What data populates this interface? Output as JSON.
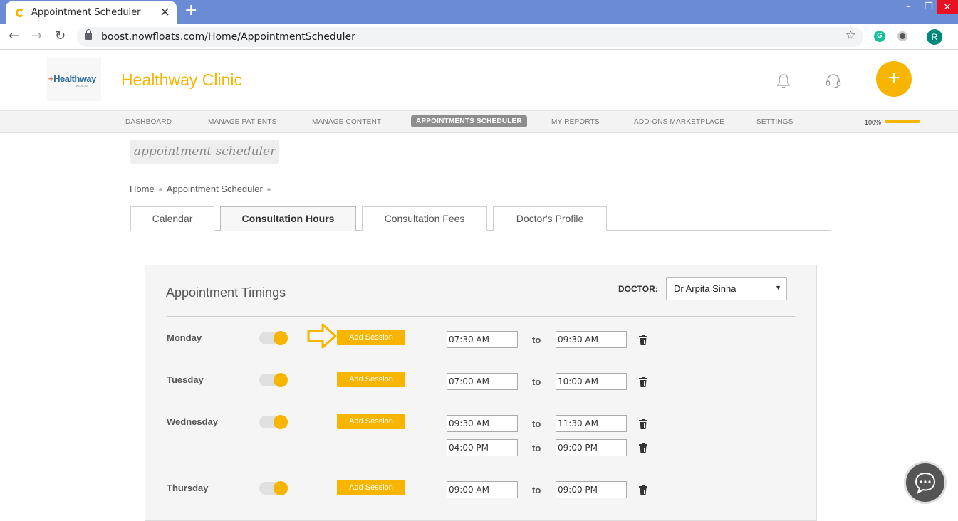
{
  "browser": {
    "tab_title": "Appointment Scheduler",
    "url": "boost.nowfloats.com/Home/AppointmentScheduler",
    "profile_initial": "R",
    "extension_initial": "G"
  },
  "header": {
    "logo_plus": "+",
    "logo_text": "Healthway",
    "logo_sub": "MEDICAL",
    "clinic_name": "Healthway Clinic",
    "add_label": "+"
  },
  "nav": {
    "items": [
      {
        "label": "DASHBOARD"
      },
      {
        "label": "MANAGE PATIENTS"
      },
      {
        "label": "MANAGE CONTENT"
      },
      {
        "label": "APPOINTMENTS SCHEDULER"
      },
      {
        "label": "MY REPORTS"
      },
      {
        "label": "ADD-ONS MARKETPLACE"
      },
      {
        "label": "SETTINGS"
      }
    ],
    "progress_label": "100%",
    "progress_fraction": 1.0
  },
  "page": {
    "title": "appointment scheduler",
    "breadcrumb": [
      "Home",
      "Appointment Scheduler"
    ]
  },
  "tabs": [
    {
      "label": "Calendar"
    },
    {
      "label": "Consultation Hours"
    },
    {
      "label": "Consultation Fees"
    },
    {
      "label": "Doctor's Profile"
    }
  ],
  "panel": {
    "title": "Appointment Timings",
    "doctor_label": "DOCTOR:",
    "doctor_value": "Dr Arpita Sinha",
    "add_session_label": "Add Session",
    "to_label": "to",
    "days": [
      {
        "day": "Monday",
        "enabled": true,
        "sessions": [
          {
            "from": "07:30 AM",
            "to": "09:30 AM"
          }
        ]
      },
      {
        "day": "Tuesday",
        "enabled": true,
        "sessions": [
          {
            "from": "07:00 AM",
            "to": "10:00 AM"
          }
        ]
      },
      {
        "day": "Wednesday",
        "enabled": true,
        "sessions": [
          {
            "from": "09:30 AM",
            "to": "11:30 AM"
          },
          {
            "from": "04:00 PM",
            "to": "09:00 PM"
          }
        ]
      },
      {
        "day": "Thursday",
        "enabled": true,
        "sessions": [
          {
            "from": "09:00 AM",
            "to": "09:00 PM"
          }
        ]
      }
    ]
  },
  "colors": {
    "accent": "#f7b500",
    "browser_tabbar": "#6b8cd5"
  }
}
